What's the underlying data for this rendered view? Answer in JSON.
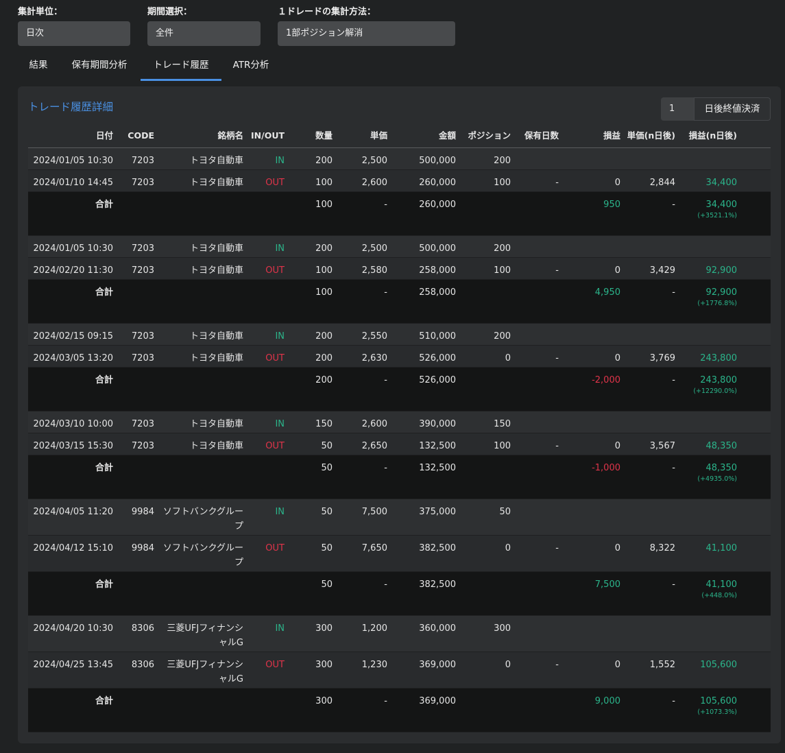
{
  "filters": [
    {
      "label": "集計単位：",
      "value": "日次"
    },
    {
      "label": "期間選択：",
      "value": "全件"
    },
    {
      "label": "１ドレードの集計方法：",
      "value": "1部ポジション解消"
    }
  ],
  "tabs": [
    {
      "label": "結果",
      "active": false
    },
    {
      "label": "保有期間分析",
      "active": false
    },
    {
      "label": "トレード履歴",
      "active": true
    },
    {
      "label": "ATR分析",
      "active": false
    }
  ],
  "panel": {
    "title": "トレード履歴詳細",
    "days_value": "1",
    "days_button": "日後終値決済"
  },
  "columns": [
    "日付",
    "CODE",
    "銘柄名",
    "IN/OUT",
    "数量",
    "単価",
    "金額",
    "ポジション",
    "保有日数",
    "損益",
    "単価(n日後)",
    "損益(n日後)"
  ],
  "colors": {
    "in": "#2bb58b",
    "out": "#e0344a",
    "accent": "#4a90e2"
  },
  "groups": [
    {
      "trades": [
        {
          "date": "2024/01/05 10:30",
          "code": "7203",
          "name": "トヨタ自動車",
          "dir": "IN",
          "qty": "200",
          "price": "2,500",
          "amount": "500,000",
          "position": "200",
          "days": "",
          "pl": "",
          "price_n": "",
          "pl_n": ""
        },
        {
          "date": "2024/01/10 14:45",
          "code": "7203",
          "name": "トヨタ自動車",
          "dir": "OUT",
          "qty": "100",
          "price": "2,600",
          "amount": "260,000",
          "position": "100",
          "days": "-",
          "pl": "0",
          "price_n": "2,844",
          "pl_n": "34,400"
        }
      ],
      "total": {
        "label": "合計",
        "qty": "100",
        "price": "-",
        "amount": "260,000",
        "pl": "950",
        "pl_sign": "pos",
        "price_n": "-",
        "pl_n": "34,400",
        "pct": "(+3521.1%)"
      }
    },
    {
      "trades": [
        {
          "date": "2024/01/05 10:30",
          "code": "7203",
          "name": "トヨタ自動車",
          "dir": "IN",
          "qty": "200",
          "price": "2,500",
          "amount": "500,000",
          "position": "200",
          "days": "",
          "pl": "",
          "price_n": "",
          "pl_n": ""
        },
        {
          "date": "2024/02/20 11:30",
          "code": "7203",
          "name": "トヨタ自動車",
          "dir": "OUT",
          "qty": "100",
          "price": "2,580",
          "amount": "258,000",
          "position": "100",
          "days": "-",
          "pl": "0",
          "price_n": "3,429",
          "pl_n": "92,900"
        }
      ],
      "total": {
        "label": "合計",
        "qty": "100",
        "price": "-",
        "amount": "258,000",
        "pl": "4,950",
        "pl_sign": "pos",
        "price_n": "-",
        "pl_n": "92,900",
        "pct": "(+1776.8%)"
      }
    },
    {
      "trades": [
        {
          "date": "2024/02/15 09:15",
          "code": "7203",
          "name": "トヨタ自動車",
          "dir": "IN",
          "qty": "200",
          "price": "2,550",
          "amount": "510,000",
          "position": "200",
          "days": "",
          "pl": "",
          "price_n": "",
          "pl_n": ""
        },
        {
          "date": "2024/03/05 13:20",
          "code": "7203",
          "name": "トヨタ自動車",
          "dir": "OUT",
          "qty": "200",
          "price": "2,630",
          "amount": "526,000",
          "position": "0",
          "days": "-",
          "pl": "0",
          "price_n": "3,769",
          "pl_n": "243,800"
        }
      ],
      "total": {
        "label": "合計",
        "qty": "200",
        "price": "-",
        "amount": "526,000",
        "pl": "-2,000",
        "pl_sign": "neg",
        "price_n": "-",
        "pl_n": "243,800",
        "pct": "(+12290.0%)"
      }
    },
    {
      "trades": [
        {
          "date": "2024/03/10 10:00",
          "code": "7203",
          "name": "トヨタ自動車",
          "dir": "IN",
          "qty": "150",
          "price": "2,600",
          "amount": "390,000",
          "position": "150",
          "days": "",
          "pl": "",
          "price_n": "",
          "pl_n": ""
        },
        {
          "date": "2024/03/15 15:30",
          "code": "7203",
          "name": "トヨタ自動車",
          "dir": "OUT",
          "qty": "50",
          "price": "2,650",
          "amount": "132,500",
          "position": "100",
          "days": "-",
          "pl": "0",
          "price_n": "3,567",
          "pl_n": "48,350"
        }
      ],
      "total": {
        "label": "合計",
        "qty": "50",
        "price": "-",
        "amount": "132,500",
        "pl": "-1,000",
        "pl_sign": "neg",
        "price_n": "-",
        "pl_n": "48,350",
        "pct": "(+4935.0%)"
      }
    },
    {
      "trades": [
        {
          "date": "2024/04/05 11:20",
          "code": "9984",
          "name": "ソフトバンクグループ",
          "dir": "IN",
          "qty": "50",
          "price": "7,500",
          "amount": "375,000",
          "position": "50",
          "days": "",
          "pl": "",
          "price_n": "",
          "pl_n": ""
        },
        {
          "date": "2024/04/12 15:10",
          "code": "9984",
          "name": "ソフトバンクグループ",
          "dir": "OUT",
          "qty": "50",
          "price": "7,650",
          "amount": "382,500",
          "position": "0",
          "days": "-",
          "pl": "0",
          "price_n": "8,322",
          "pl_n": "41,100"
        }
      ],
      "total": {
        "label": "合計",
        "qty": "50",
        "price": "-",
        "amount": "382,500",
        "pl": "7,500",
        "pl_sign": "pos",
        "price_n": "-",
        "pl_n": "41,100",
        "pct": "(+448.0%)"
      }
    },
    {
      "trades": [
        {
          "date": "2024/04/20 10:30",
          "code": "8306",
          "name": "三菱UFJフィナンシャルG",
          "dir": "IN",
          "qty": "300",
          "price": "1,200",
          "amount": "360,000",
          "position": "300",
          "days": "",
          "pl": "",
          "price_n": "",
          "pl_n": ""
        },
        {
          "date": "2024/04/25 13:45",
          "code": "8306",
          "name": "三菱UFJフィナンシャルG",
          "dir": "OUT",
          "qty": "300",
          "price": "1,230",
          "amount": "369,000",
          "position": "0",
          "days": "-",
          "pl": "0",
          "price_n": "1,552",
          "pl_n": "105,600"
        }
      ],
      "total": {
        "label": "合計",
        "qty": "300",
        "price": "-",
        "amount": "369,000",
        "pl": "9,000",
        "pl_sign": "pos",
        "price_n": "-",
        "pl_n": "105,600",
        "pct": "(+1073.3%)"
      }
    }
  ]
}
